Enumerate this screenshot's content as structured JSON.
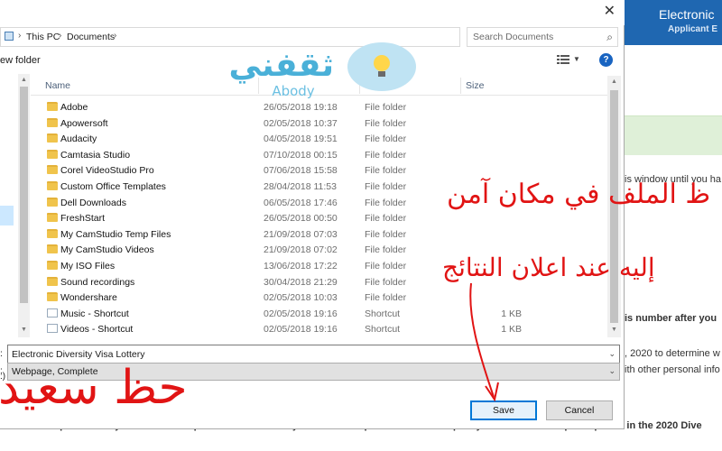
{
  "background_page": {
    "header_title": "Electronic",
    "header_subtitle": "Applicant E",
    "lines": [
      "is window until you ha",
      "is number after you",
      ", 2020 to determine w",
      "ith other personal info"
    ],
    "bottom_line": "eptional Entry Form with this person as the Primary Entrant. Multiple entries will disqualify the Entrant from participation in the 2020 Dive"
  },
  "dialog": {
    "breadcrumb": [
      "This PC",
      "Documents"
    ],
    "search_placeholder": "Search Documents",
    "toolbar": {
      "new_folder_label": "ew folder",
      "help_label": "?"
    },
    "nav_partial_label": ":)",
    "columns": {
      "name": "Name",
      "size": "Size"
    },
    "rows": [
      {
        "name": "Adobe",
        "date": "26/05/2018 19:18",
        "type": "File folder",
        "size": "",
        "icon": "folder-icon"
      },
      {
        "name": "Apowersoft",
        "date": "02/05/2018 10:37",
        "type": "File folder",
        "size": "",
        "icon": "folder-icon"
      },
      {
        "name": "Audacity",
        "date": "04/05/2018 19:51",
        "type": "File folder",
        "size": "",
        "icon": "folder-icon"
      },
      {
        "name": "Camtasia Studio",
        "date": "07/10/2018 00:15",
        "type": "File folder",
        "size": "",
        "icon": "folder-icon"
      },
      {
        "name": "Corel VideoStudio Pro",
        "date": "07/06/2018 15:58",
        "type": "File folder",
        "size": "",
        "icon": "folder-icon"
      },
      {
        "name": "Custom Office Templates",
        "date": "28/04/2018 11:53",
        "type": "File folder",
        "size": "",
        "icon": "folder-icon"
      },
      {
        "name": "Dell Downloads",
        "date": "06/05/2018 17:46",
        "type": "File folder",
        "size": "",
        "icon": "folder-icon"
      },
      {
        "name": "FreshStart",
        "date": "26/05/2018 00:50",
        "type": "File folder",
        "size": "",
        "icon": "folder-icon"
      },
      {
        "name": "My CamStudio Temp Files",
        "date": "21/09/2018 07:03",
        "type": "File folder",
        "size": "",
        "icon": "folder-icon"
      },
      {
        "name": "My CamStudio Videos",
        "date": "21/09/2018 07:02",
        "type": "File folder",
        "size": "",
        "icon": "folder-icon"
      },
      {
        "name": "My ISO Files",
        "date": "13/06/2018 17:22",
        "type": "File folder",
        "size": "",
        "icon": "folder-icon"
      },
      {
        "name": "Sound recordings",
        "date": "30/04/2018 21:29",
        "type": "File folder",
        "size": "",
        "icon": "folder-icon"
      },
      {
        "name": "Wondershare",
        "date": "02/05/2018 10:03",
        "type": "File folder",
        "size": "",
        "icon": "folder-icon"
      },
      {
        "name": "Music - Shortcut",
        "date": "02/05/2018 19:16",
        "type": "Shortcut",
        "size": "1 KB",
        "icon": "music-shortcut-icon"
      },
      {
        "name": "Videos - Shortcut",
        "date": "02/05/2018 19:16",
        "type": "Shortcut",
        "size": "1 KB",
        "icon": "video-shortcut-icon"
      }
    ],
    "filename_value": "Electronic Diversity Visa Lottery",
    "filetype_value": "Webpage, Complete",
    "filename_side_label": ":",
    "filetype_side_label": ":",
    "save_label": "Save",
    "cancel_label": "Cancel"
  },
  "overlay": {
    "arabic_line_1": "ظ الملف في مكان آمن",
    "arabic_line_2": "إليه عند اعلان النتائج",
    "arabic_line_3": "حظ سعيد",
    "logo_arabic": "ثقفني",
    "logo_latin": "Abody"
  },
  "colors": {
    "header_blue": "#1f67b1",
    "overlay_red": "#e11414",
    "folder_yellow": "#f0c44c"
  }
}
